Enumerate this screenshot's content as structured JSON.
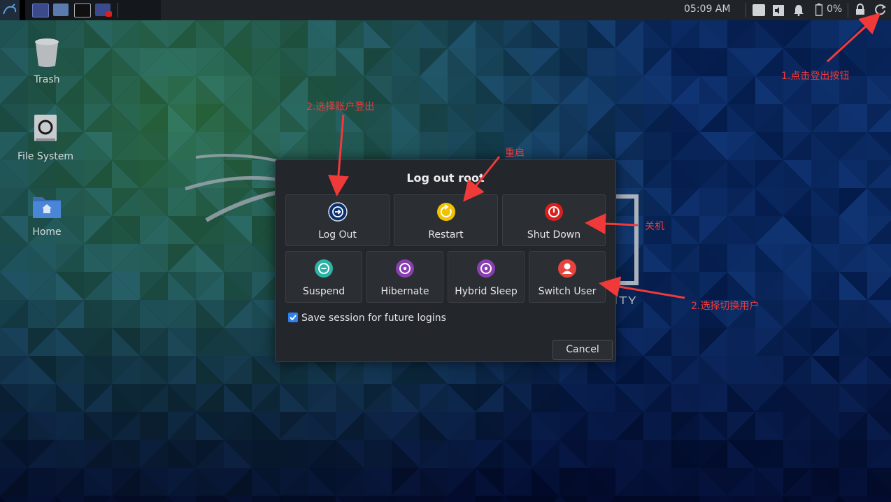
{
  "panel": {
    "clock": "05:09 AM",
    "battery": "0%",
    "icons": [
      "kali-menu-icon",
      "workspace-1-icon",
      "file-manager-icon",
      "terminal-icon",
      "screenshot-icon",
      "cpu-icon",
      "volume-icon",
      "notification-bell-icon",
      "battery-icon",
      "lock-icon",
      "logout-icon"
    ]
  },
  "desktop": {
    "items": [
      {
        "label": "Trash",
        "icon": "trash-icon"
      },
      {
        "label": "File System",
        "icon": "drive-icon"
      },
      {
        "label": "Home",
        "icon": "home-folder-icon"
      }
    ],
    "bg_text": "ITY"
  },
  "dialog": {
    "title": "Log out root",
    "buttons": [
      {
        "label": "Log Out",
        "icon": "logout-icon",
        "color": "#0e3d8a"
      },
      {
        "label": "Restart",
        "icon": "restart-icon",
        "color": "#f2c200"
      },
      {
        "label": "Shut Down",
        "icon": "power-icon",
        "color": "#d8201e"
      },
      {
        "label": "Suspend",
        "icon": "suspend-icon",
        "color": "#2bb3a5"
      },
      {
        "label": "Hibernate",
        "icon": "hibernate-icon",
        "color": "#8a3fb1"
      },
      {
        "label": "Hybrid Sleep",
        "icon": "hybrid-sleep-icon",
        "color": "#8a3fb1"
      },
      {
        "label": "Switch User",
        "icon": "user-icon",
        "color": "#e8433c"
      }
    ],
    "save_session_label": "Save session for future logins",
    "save_session_checked": true,
    "cancel_label": "Cancel"
  },
  "annotations": {
    "click_logout": "1.点击登出按钮",
    "choose_logout": "2.选择账户登出",
    "restart": "重启",
    "shutdown": "关机",
    "switch_user": "2.选择切换用户",
    "color": "#f03a3a"
  }
}
